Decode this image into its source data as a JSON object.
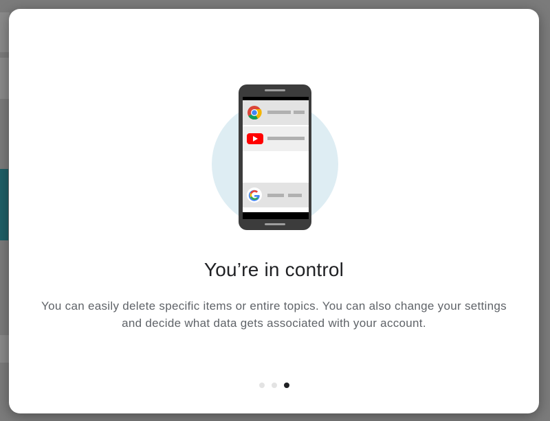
{
  "dialog": {
    "headline": "You’re in control",
    "body": "You can easily delete specific items or entire topics. You can also change your settings and decide what data gets associated with your account.",
    "illustration": {
      "icons": [
        "chrome-icon",
        "youtube-icon",
        "google-icon"
      ]
    },
    "pager": {
      "total": 3,
      "current": 3
    }
  },
  "colors": {
    "circle": "#deedf3",
    "phone": "#3c3c3c",
    "active_dot": "#202124",
    "inactive_dot": "#e3e3e3"
  }
}
